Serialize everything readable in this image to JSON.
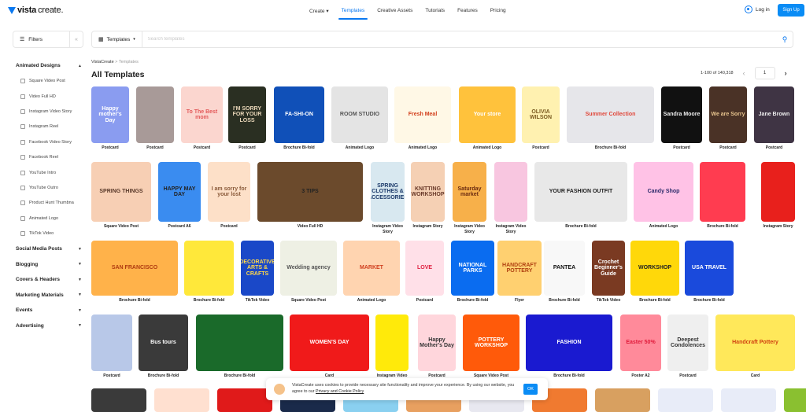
{
  "header": {
    "logo_bold": "vista",
    "logo_light": "create.",
    "nav": [
      {
        "label": "Create ▾",
        "active": false
      },
      {
        "label": "Templates",
        "active": true
      },
      {
        "label": "Creative Assets",
        "active": false
      },
      {
        "label": "Tutorials",
        "active": false
      },
      {
        "label": "Features",
        "active": false
      },
      {
        "label": "Pricing",
        "active": false
      }
    ],
    "login_label": "Log in",
    "signup_label": "Sign Up"
  },
  "toolbar": {
    "filters_label": "Filters",
    "collapse_glyph": "«",
    "type_select": "Templates",
    "search_placeholder": "Search templates",
    "search_value": ""
  },
  "sidebar": {
    "sections": [
      {
        "label": "Animated Designs",
        "expanded": true,
        "items": [
          "Square Video Post",
          "Video Full HD",
          "Instagram Video Story",
          "Instagram Reel",
          "Facebook Video Story",
          "Facebook Reel",
          "YouTube Intro",
          "YouTube Outro",
          "Product Hunt Thumbna",
          "Animated Logo",
          "TikTok Video"
        ]
      },
      {
        "label": "Social Media Posts",
        "expanded": false
      },
      {
        "label": "Blogging",
        "expanded": false
      },
      {
        "label": "Covers & Headers",
        "expanded": false
      },
      {
        "label": "Marketing Materials",
        "expanded": false
      },
      {
        "label": "Events",
        "expanded": false
      },
      {
        "label": "Advertising",
        "expanded": false
      }
    ]
  },
  "main": {
    "breadcrumb_root": "VistaCreate",
    "breadcrumb_sep": " > ",
    "breadcrumb_current": "Templates",
    "title": "All Templates",
    "pagination": {
      "range": "1-100 of 140,318",
      "page": "1"
    },
    "rows": [
      [
        {
          "label": "Postcard",
          "text": "Happy mother's Day",
          "bg": "#8a9cf0",
          "fg": "#fff"
        },
        {
          "label": "Postcard",
          "text": "",
          "bg": "#a89a98",
          "fg": "#fff"
        },
        {
          "label": "Postcard",
          "text": "To The Best mom",
          "bg": "#fbd6cf",
          "fg": "#e35a5a"
        },
        {
          "label": "Postcard",
          "text": "I'M SORRY FOR YOUR LOSS",
          "bg": "#2a2f22",
          "fg": "#e8d6b8"
        },
        {
          "label": "Brochure Bi-fold",
          "text": "FA-SHI-ON",
          "bg": "#1050b8",
          "fg": "#fff"
        },
        {
          "label": "Animated Logo",
          "text": "ROOM STUDIO",
          "bg": "#e4e4e4",
          "fg": "#555"
        },
        {
          "label": "Animated Logo",
          "text": "Fresh Meal",
          "bg": "#fff8e6",
          "fg": "#d23f1c"
        },
        {
          "label": "Animated Logo",
          "text": "Your store",
          "bg": "#ffc23c",
          "fg": "#fff"
        },
        {
          "label": "Postcard",
          "text": "OLIVIA WILSON",
          "bg": "#fff1b0",
          "fg": "#7a5a20"
        },
        {
          "label": "Brochure Bi-fold",
          "text": "Summer Collection",
          "bg": "#e6e6ea",
          "fg": "#e0473a"
        },
        {
          "label": "Postcard",
          "text": "Sandra Moore",
          "bg": "#111",
          "fg": "#eee"
        },
        {
          "label": "Postcard",
          "text": "We are Sorry",
          "bg": "#4a3226",
          "fg": "#e7c48e"
        },
        {
          "label": "Postcard",
          "text": "Jane Brown",
          "bg": "#3f3444",
          "fg": "#eee"
        }
      ],
      [
        {
          "label": "Square Video Post",
          "text": "SPRING THINGS",
          "bg": "#f7cfb4",
          "fg": "#5a3a2a"
        },
        {
          "label": "Postcard A6",
          "text": "HAPPY MAY DAY",
          "bg": "#3a8cf0",
          "fg": "#222"
        },
        {
          "label": "Postcard",
          "text": "I am sorry for your lost",
          "bg": "#fde0c8",
          "fg": "#8a5a3a"
        },
        {
          "label": "Video Full HD",
          "text": "3 TIPS",
          "bg": "#6b4a2c",
          "fg": "#222"
        },
        {
          "label": "Instagram Video Story",
          "text": "SPRING CLOTHES & ACCESSORIES",
          "bg": "#d8e8f0",
          "fg": "#1c3a6a"
        },
        {
          "label": "Instagram Story",
          "text": "KNITTING WORKSHOP",
          "bg": "#f5d0b4",
          "fg": "#6a3a2a"
        },
        {
          "label": "Instagram Video Story",
          "text": "Saturday market",
          "bg": "#f7b04a",
          "fg": "#6a2a10"
        },
        {
          "label": "Instagram Video Story",
          "text": "",
          "bg": "#f8c6e0",
          "fg": "#333"
        },
        {
          "label": "Brochure Bi-fold",
          "text": "YOUR FASHION OUTFIT",
          "bg": "#e8e8e8",
          "fg": "#222"
        },
        {
          "label": "Animated Logo",
          "text": "Candy Shop",
          "bg": "#ffc2e6",
          "fg": "#2a2a6a"
        },
        {
          "label": "Brochure Bi-fold",
          "text": "",
          "bg": "#ff3c50",
          "fg": "#fff"
        },
        {
          "label": "Instagram Story",
          "text": "",
          "bg": "#e8201c",
          "fg": "#fff"
        }
      ],
      [
        {
          "label": "Brochure Bi-fold",
          "text": "SAN FRANCISCO",
          "bg": "#ffb24a",
          "fg": "#b03a10"
        },
        {
          "label": "Brochure Bi-fold",
          "text": "",
          "bg": "#ffe83a",
          "fg": "#333"
        },
        {
          "label": "TikTok Video",
          "text": "DECORATIVE ARTS & CRAFTS",
          "bg": "#1a48c8",
          "fg": "#ffd84a"
        },
        {
          "label": "Square Video Post",
          "text": "Wedding agency",
          "bg": "#eef0e4",
          "fg": "#555"
        },
        {
          "label": "Animated Logo",
          "text": "MARKET",
          "bg": "#ffd4b0",
          "fg": "#d04020"
        },
        {
          "label": "Postcard",
          "text": "LOVE",
          "bg": "#ffe0e8",
          "fg": "#e02040"
        },
        {
          "label": "Brochure Bi-fold",
          "text": "NATIONAL PARKS",
          "bg": "#0a6cf0",
          "fg": "#fff"
        },
        {
          "label": "Flyer",
          "text": "HANDCRAFT POTTERY",
          "bg": "#ffd070",
          "fg": "#b04010"
        },
        {
          "label": "Brochure Bi-fold",
          "text": "PANTEA",
          "bg": "#f8f8f8",
          "fg": "#111"
        },
        {
          "label": "TikTok Video",
          "text": "Crochet Beginner's Guide",
          "bg": "#7a3a22",
          "fg": "#fff"
        },
        {
          "label": "Brochure Bi-fold",
          "text": "WORKSHOP",
          "bg": "#ffd80a",
          "fg": "#222"
        },
        {
          "label": "Brochure Bi-fold",
          "text": "USA TRAVEL",
          "bg": "#1a4adc",
          "fg": "#fff"
        }
      ],
      [
        {
          "label": "Postcard",
          "text": "",
          "bg": "#b8c8e8",
          "fg": "#333"
        },
        {
          "label": "Brochure Bi-fold",
          "text": "Bus tours",
          "bg": "#3a3a3a",
          "fg": "#fff"
        },
        {
          "label": "Brochure Bi-fold",
          "text": "",
          "bg": "#1a6a2a",
          "fg": "#fff"
        },
        {
          "label": "Card",
          "text": "WOMEN'S DAY",
          "bg": "#f01a1a",
          "fg": "#fff"
        },
        {
          "label": "Instagram Video",
          "text": "",
          "bg": "#ffea0a",
          "fg": "#333"
        },
        {
          "label": "Postcard",
          "text": "Happy Mother's Day",
          "bg": "#ffd6dc",
          "fg": "#333"
        },
        {
          "label": "Square Video Post",
          "text": "POTTERY WORKSHOP",
          "bg": "#ff5a0a",
          "fg": "#fff"
        },
        {
          "label": "Brochure Bi-fold",
          "text": "FASHION",
          "bg": "#1a1ad0",
          "fg": "#fff"
        },
        {
          "label": "Poster A2",
          "text": "Easter 50%",
          "bg": "#ff8a9a",
          "fg": "#e01a3a"
        },
        {
          "label": "Postcard",
          "text": "Deepest Condolences",
          "bg": "#efefef",
          "fg": "#333"
        },
        {
          "label": "Card",
          "text": "Handcraft Pottery",
          "bg": "#ffe85a",
          "fg": "#d04010"
        }
      ]
    ]
  },
  "cookie": {
    "text": "VistaCreate uses cookies to provide necessary site functionality and improve your experience. By using our website, you agree to our ",
    "link": "Privacy and Cookie Policy",
    "ok_label": "OK"
  }
}
